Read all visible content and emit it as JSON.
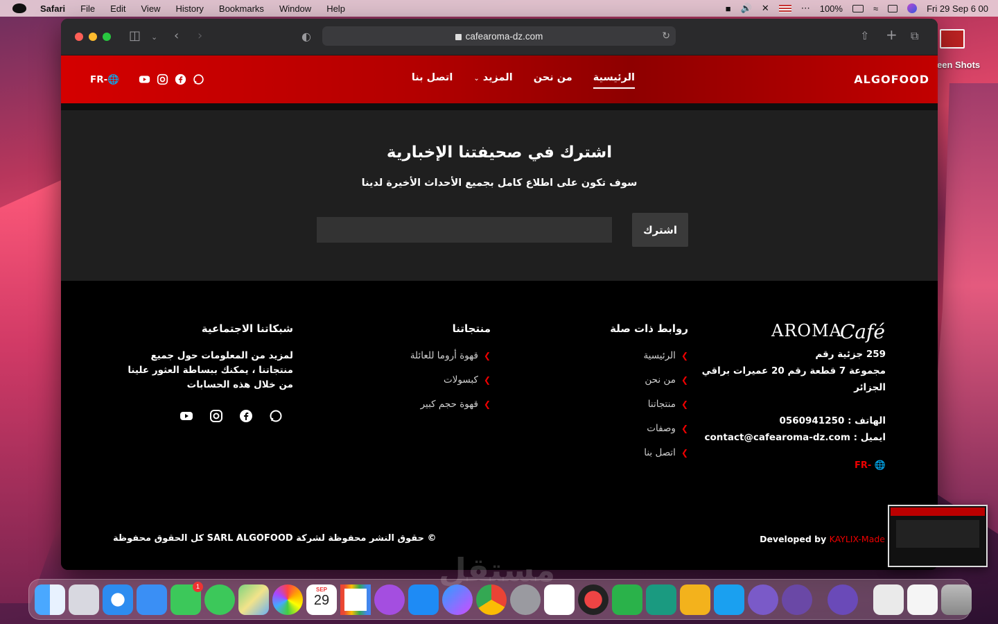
{
  "menubar": {
    "app_name": "Safari",
    "items": [
      "File",
      "Edit",
      "View",
      "History",
      "Bookmarks",
      "Window",
      "Help"
    ],
    "battery": "100%",
    "datetime": "Fri 29 Sep  6 00"
  },
  "desktop": {
    "screenshots_label": "een Shots"
  },
  "browser": {
    "url": "cafearoma-dz.com"
  },
  "site": {
    "brand": "ALGOFOOD",
    "nav": [
      "الرئيسية",
      "من نحن",
      "المزيد",
      "اتصل بنا"
    ],
    "lang_switch": "FR-",
    "newsletter": {
      "title": "اشترك في صحيفتنا الإخبارية",
      "subtitle": "سوف تكون على اطلاع كامل بجميع الأحداث الأخيرة لدينا",
      "input_placeholder": "",
      "button": "اشترك"
    },
    "footer": {
      "logo_main": "AROMA",
      "logo_script": "Café",
      "address_lines": [
        "259 جزئية رقم",
        "مجموعة 7 قطعة رقم 20 عميرات براقي",
        "الجزائر"
      ],
      "phone": "الهاتف : 0560941250",
      "email": "ايميل : contact@cafearoma-dz.com",
      "lang": "FR-",
      "links_title": "روابط ذات صلة",
      "links": [
        "الرئيسية",
        "من نحن",
        "منتجاتنا",
        "وصفات",
        "اتصل بنا"
      ],
      "products_title": "منتجاتنا",
      "products": [
        "قهوة أروما للعائلة",
        "كبسولات",
        "قهوة حجم كبير"
      ],
      "social_title": "شبكاتنا الاجتماعية",
      "social_text": "لمزيد من المعلومات حول جميع منتجاتنا ، يمكنك ببساطة العثور علينا من خلال هذه الحسابات",
      "copyright": "© حقوق النشر محفوظة لشركة SARL ALGOFOOD كل الحقوق محفوظة",
      "developed_by": "Developed by",
      "developer": "KAYLIX-Made"
    }
  },
  "calendar_icon": {
    "month": "SEP",
    "day": "29"
  },
  "messages_badge": "1",
  "watermark": "مستقل"
}
